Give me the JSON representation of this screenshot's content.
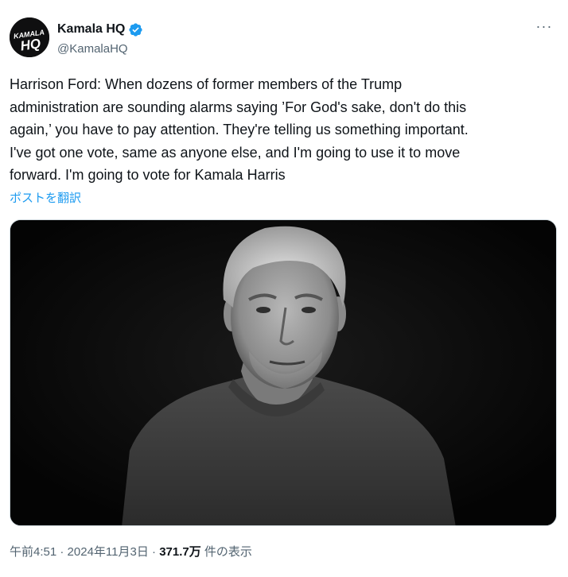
{
  "author": {
    "display_name": "Kamala HQ",
    "handle": "@KamalaHQ",
    "avatar_text_line1": "KAMALA",
    "avatar_text_line2": "HQ",
    "verified": true
  },
  "more_label": "···",
  "tweet_text": "Harrison Ford: When dozens of former members of the Trump\nadministration are sounding alarms saying ’For God's sake, don't do this\nagain,’ you have to pay attention. They're telling us something important.\nI've got one vote, same as anyone else, and I'm going to use it to move\nforward. I'm going to vote for Kamala Harris",
  "translate_label": "ポストを翻訳",
  "meta": {
    "time": "午前4:51",
    "separator": " · ",
    "date": "2024年11月3日",
    "views_count": "371.7万",
    "views_label": " 件の表示"
  },
  "colors": {
    "link": "#1d9bf0",
    "secondary": "#536471",
    "verified": "#1d9bf0"
  }
}
